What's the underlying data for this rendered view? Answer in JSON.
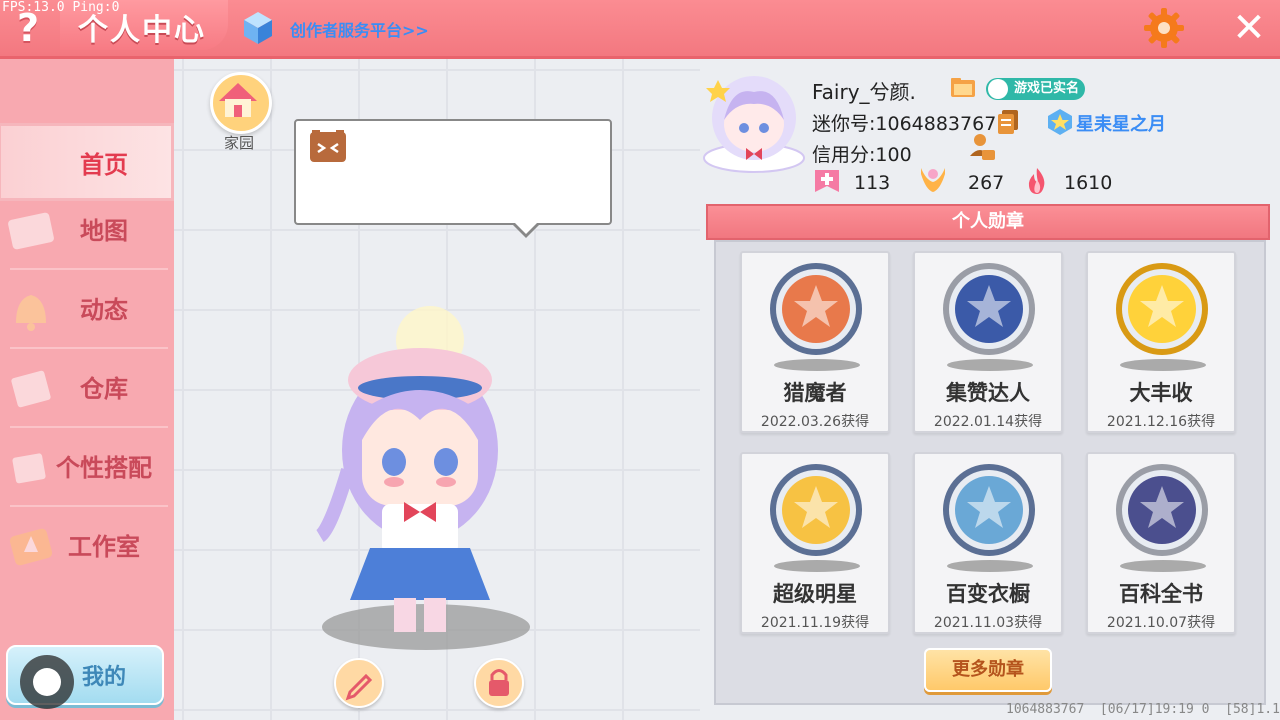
{
  "debug": {
    "fps_ping": "FPS:13.0  Ping:0"
  },
  "topbar": {
    "help": "?",
    "title": "个人中心",
    "creator_link": "创作者服务平台>>",
    "close": "✕"
  },
  "sidebar": {
    "items": [
      {
        "label": "首页",
        "active": true
      },
      {
        "label": "地图",
        "active": false
      },
      {
        "label": "动态",
        "active": false
      },
      {
        "label": "仓库",
        "active": false
      },
      {
        "label": "个性搭配",
        "active": false
      },
      {
        "label": "工作室",
        "active": false
      }
    ],
    "mine_label": "我的"
  },
  "center": {
    "home_label": "家园"
  },
  "profile": {
    "nickname": "Fairy_兮颜.",
    "verified_label": "游戏已实名",
    "mini_id": "迷你号:1064883767",
    "rank_label": "星耒星之月",
    "credit": "信用分:100",
    "stats": [
      {
        "icon": "plus-card-icon",
        "value": "113"
      },
      {
        "icon": "cheer-icon",
        "value": "267"
      },
      {
        "icon": "flame-icon",
        "value": "1610"
      }
    ]
  },
  "medals": {
    "header": "个人勋章",
    "items": [
      {
        "name": "猎魔者",
        "date": "2022.03.26获得",
        "ring": "#5b6f94",
        "face": "#e8794b"
      },
      {
        "name": "集赞达人",
        "date": "2022.01.14获得",
        "ring": "#9a9da6",
        "face": "#3b5aa8"
      },
      {
        "name": "大丰收",
        "date": "2021.12.16获得",
        "ring": "#d99a14",
        "face": "#ffd23a"
      },
      {
        "name": "超级明星",
        "date": "2021.11.19获得",
        "ring": "#5b6f94",
        "face": "#f7c243"
      },
      {
        "name": "百变衣橱",
        "date": "2021.11.03获得",
        "ring": "#5b6f94",
        "face": "#6aa8d6"
      },
      {
        "name": "百科全书",
        "date": "2021.10.07获得",
        "ring": "#9a9da6",
        "face": "#4b4f8e"
      }
    ],
    "more_label": "更多勋章"
  },
  "footer": {
    "info": "1064883767  [06/17]19:19 0  [58]1.13.0"
  }
}
